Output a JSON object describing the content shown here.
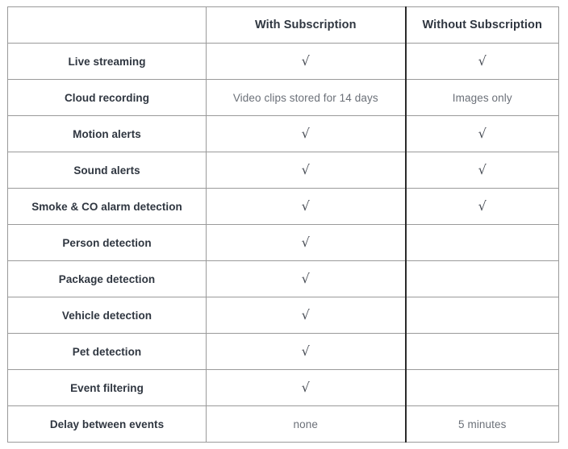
{
  "table": {
    "columns": [
      {
        "key": "feature",
        "label": ""
      },
      {
        "key": "with",
        "label": "With Subscription"
      },
      {
        "key": "without",
        "label": "Without Subscription"
      }
    ],
    "check_glyph": "√",
    "rows": [
      {
        "feature": "Live streaming",
        "with": "√",
        "without": "√",
        "with_type": "check",
        "without_type": "check"
      },
      {
        "feature": "Cloud recording",
        "with": "Video clips stored for 14 days",
        "without": "Images only",
        "with_type": "text",
        "without_type": "text"
      },
      {
        "feature": "Motion alerts",
        "with": "√",
        "without": "√",
        "with_type": "check",
        "without_type": "check"
      },
      {
        "feature": "Sound alerts",
        "with": "√",
        "without": "√",
        "with_type": "check",
        "without_type": "check"
      },
      {
        "feature": "Smoke & CO alarm detection",
        "with": "√",
        "without": "√",
        "with_type": "check",
        "without_type": "check"
      },
      {
        "feature": "Person detection",
        "with": "√",
        "without": "",
        "with_type": "check",
        "without_type": "empty"
      },
      {
        "feature": "Package detection",
        "with": "√",
        "without": "",
        "with_type": "check",
        "without_type": "empty"
      },
      {
        "feature": "Vehicle detection",
        "with": "√",
        "without": "",
        "with_type": "check",
        "without_type": "empty"
      },
      {
        "feature": "Pet detection",
        "with": "√",
        "without": "",
        "with_type": "check",
        "without_type": "empty"
      },
      {
        "feature": "Event filtering",
        "with": "√",
        "without": "",
        "with_type": "check",
        "without_type": "empty"
      },
      {
        "feature": "Delay between events",
        "with": "none",
        "without": "5 minutes",
        "with_type": "text",
        "without_type": "text"
      }
    ]
  },
  "colors": {
    "border": "#9a9a9a",
    "border_strong": "#2b2b2b",
    "heading_text": "#2f3640",
    "body_text": "#6b7078",
    "background": "#ffffff"
  }
}
